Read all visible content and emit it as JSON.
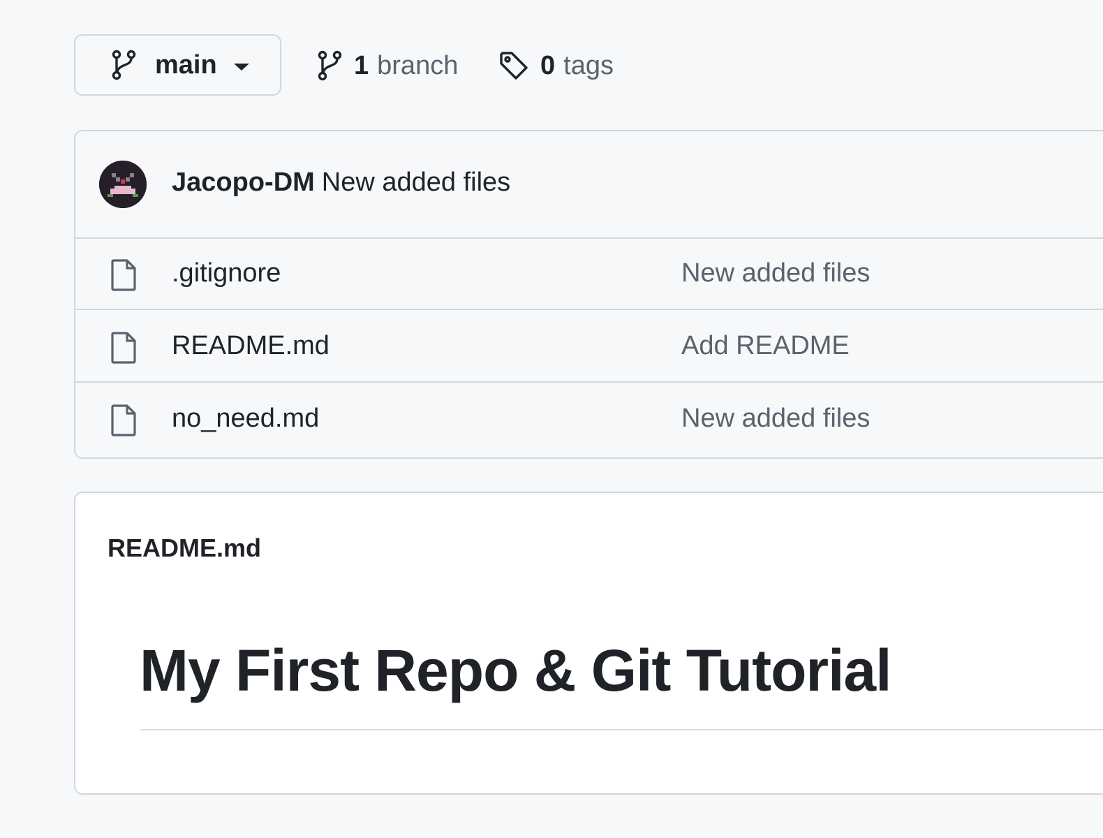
{
  "toolbar": {
    "branch_label": "main",
    "branches_count": "1",
    "branches_word": "branch",
    "tags_count": "0",
    "tags_word": "tags"
  },
  "commit": {
    "author": "Jacopo-DM",
    "message": "New added files"
  },
  "files": [
    {
      "name": ".gitignore",
      "message": "New added files",
      "icon": "file-icon"
    },
    {
      "name": "README.md",
      "message": "Add README",
      "icon": "file-icon"
    },
    {
      "name": "no_need.md",
      "message": "New added files",
      "icon": "file-icon"
    }
  ],
  "readme": {
    "filename": "README.md",
    "heading": "My First Repo & Git Tutorial"
  },
  "colors": {
    "page_bg": "#f6f8fa",
    "border": "#d0d7de",
    "text_primary": "#1f2328",
    "text_muted": "#59636e"
  }
}
